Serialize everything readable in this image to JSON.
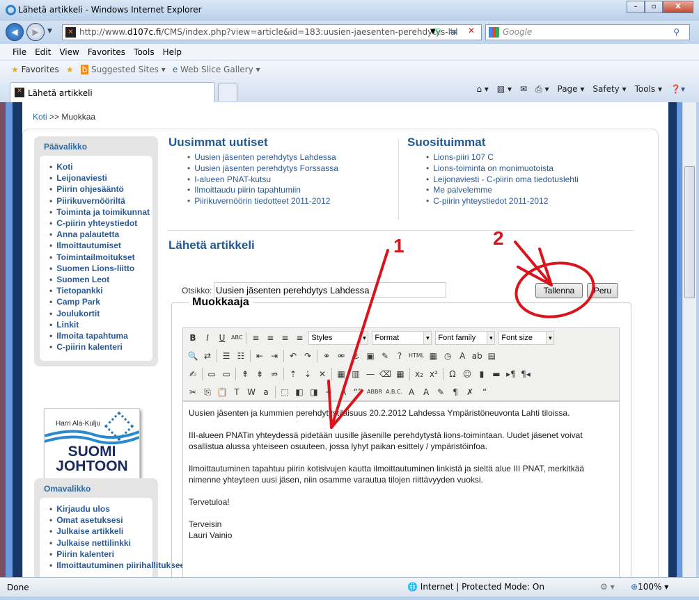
{
  "window": {
    "title": "Lähetä artikkeli - Windows Internet Explorer",
    "minimize": "–",
    "maximize": "▫",
    "close": "X"
  },
  "address": {
    "url_prefix": "http://www.",
    "url_domain": "d107c.fi",
    "url_rest": "/CMS/index.php?view=article&id=183:uusien-jaesenten-perehdytys-lal",
    "search_placeholder": "Google"
  },
  "menu": [
    "File",
    "Edit",
    "View",
    "Favorites",
    "Tools",
    "Help"
  ],
  "favorites_bar": {
    "favorites": "Favorites",
    "suggested": "Suggested Sites ▾",
    "webslice": "Web Slice Gallery ▾"
  },
  "tab": {
    "label": "Lähetä artikkeli"
  },
  "command_bar": [
    "Page ▾",
    "Safety ▾",
    "Tools ▾"
  ],
  "breadcrumb": {
    "home": "Koti",
    "sep": " >> ",
    "current": "Muokkaa"
  },
  "main_menu": {
    "title": "Päävalikko",
    "items": [
      "Koti",
      "Leijonaviesti",
      "Piirin ohjesääntö",
      "Piirikuvernööriltä",
      "Toiminta ja toimikunnat",
      "C-piirin yhteystiedot",
      "Anna palautetta",
      "Ilmoittautumiset",
      "Toimintailmoitukset",
      "Suomen Lions-liitto",
      "Suomen Leot",
      "Tietopankki",
      "Camp Park",
      "Joulukortit",
      "Linkit",
      "Ilmoita tapahtuma",
      "C-piirin kalenteri"
    ]
  },
  "logo": {
    "name": "Harri Ala-Kulju",
    "line1": "SUOMI",
    "line2": "JOHTOON"
  },
  "own_menu": {
    "title": "Omavalikko",
    "items": [
      "Kirjaudu ulos",
      "Omat asetuksesi",
      "Julkaise artikkeli",
      "Julkaise nettilinkki",
      "Piirin kalenteri",
      "Ilmoittautuminen piirihallitukseen"
    ]
  },
  "latest": {
    "title": "Uusimmat uutiset",
    "items": [
      "Uusien jäsenten perehdytys Lahdessa",
      "Uusien jäsenten perehdytys Forssassa",
      "I-alueen PNAT-kutsu",
      "Ilmoittaudu piirin tapahtumiin",
      "Piirikuvernöörin tiedotteet 2011-2012"
    ]
  },
  "popular": {
    "title": "Suosituimmat",
    "items": [
      "Lions-piiri 107 C",
      "Lions-toiminta on monimuotoista",
      "Leijonaviesti - C-piirin oma tiedotuslehti",
      "Me palvelemme",
      "C-piirin yhteystiedot 2011-2012"
    ]
  },
  "form": {
    "page_title": "Lähetä artikkeli",
    "legend": "Muokkaaja",
    "title_label": "Otsikko:",
    "title_value": "Uusien jäsenten perehdytys Lahdessa",
    "save": "Tallenna",
    "cancel": "Peru"
  },
  "toolbar": {
    "selects": [
      "Styles",
      "Format",
      "Font family",
      "Font size"
    ],
    "row1": [
      "B:bold",
      "I:italic",
      "U:underline",
      "ABC:strikethrough",
      "|",
      "≡:align-left",
      "≡:align-center",
      "≡:align-right",
      "≡:justify"
    ],
    "row2": [
      "🔍:find",
      "⇄:replace",
      "|",
      "☰:bullet-list",
      "☷:numbered-list",
      "|",
      "⇤:outdent",
      "⇥:indent",
      "|",
      "↶:undo",
      "↷:redo",
      "|",
      "⚭:link",
      "⚮:unlink",
      "⚓:anchor",
      "▣:image",
      "✎:cleanup",
      "?:help",
      "HTML:html",
      "▦:insert-date",
      "◷:insert-time",
      "A:text-color",
      "ab:highlight-color",
      "▤:fullscreen"
    ],
    "row3": [
      "✍:edit-css",
      "|",
      "▭:insert-layer",
      "▭:abs-position",
      "|",
      "⇞:row-before",
      "⇟:row-after",
      "⇏:delete-row",
      "|",
      "⇡:col-before",
      "⇣:col-after",
      "✕:delete-col",
      "|",
      "▦:split-cells",
      "▥:merge-cells",
      "—:horizontal-rule",
      "⌫:remove-format",
      "▦:visual-aid",
      "|",
      "x₂:subscript",
      "x²:superscript",
      "|",
      "Ω:special-char",
      "☺:emotions",
      "▮:media",
      "▬:advanced-hr",
      "▸¶:ltr",
      "¶◂:rtl"
    ],
    "row4": [
      "✂:cut",
      "⎘:copy",
      "📋:paste",
      "T:paste-text",
      "W:paste-word",
      "a:select-all",
      "|",
      "⬚:insert-layer-box",
      "◧:move-forward",
      "◨:move-backward",
      "+:insert-tag",
      "A:style-props",
      "“”:cite",
      "ABBR:abbr",
      "A.B.C.:acronym",
      "A:insert-text",
      "A:delete-text",
      "✎:attributes",
      "¶:show-blocks",
      "✗:nonbreaking",
      "“:blockquote"
    ]
  },
  "content": {
    "p1": "Uusien jäsenten ja kummien perehdytystilaisuus 20.2.2012 Lahdessa Ympäristöneuvonta Lahti tiloissa.",
    "p2": "III-alueen PNATin yhteydessä pidetään uusille jäsenille perehdytystä lions-toimintaan. Uudet jäsenet voivat osallistua alussa yhteiseen osuuteen, jossa lyhyt paikan esittely / ympäristöinfoa.",
    "p3": "Ilmoittautuminen tapahtuu piirin kotisivujen kautta ilmoittautuminen linkistä ja sieltä alue III PNAT, merkitkää nimenne yhteyteen uusi jäsen, niin osamme varautua tilojen riittävyyden vuoksi.",
    "p4": "Tervetuloa!",
    "p5a": "Terveisin",
    "p5b": "Lauri Vainio"
  },
  "annotations": {
    "label1": "1",
    "label2": "2",
    "color": "#d9141c"
  },
  "status": {
    "left": "Done",
    "zone": "Internet | Protected Mode: On",
    "zoom": "100%"
  }
}
